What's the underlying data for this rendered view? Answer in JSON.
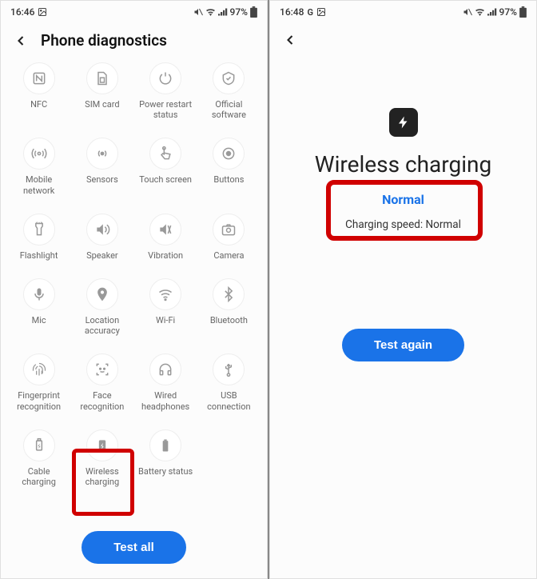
{
  "left": {
    "status": {
      "time": "16:46",
      "battery": "97%"
    },
    "title": "Phone diagnostics",
    "tiles": [
      {
        "id": "nfc",
        "label": "NFC"
      },
      {
        "id": "sim",
        "label": "SIM card"
      },
      {
        "id": "restart",
        "label": "Power restart\nstatus"
      },
      {
        "id": "software",
        "label": "Official\nsoftware"
      },
      {
        "id": "mobile",
        "label": "Mobile\nnetwork"
      },
      {
        "id": "sensors",
        "label": "Sensors"
      },
      {
        "id": "touch",
        "label": "Touch screen"
      },
      {
        "id": "buttons",
        "label": "Buttons"
      },
      {
        "id": "flashlight",
        "label": "Flashlight"
      },
      {
        "id": "speaker",
        "label": "Speaker"
      },
      {
        "id": "vibration",
        "label": "Vibration"
      },
      {
        "id": "camera",
        "label": "Camera"
      },
      {
        "id": "mic",
        "label": "Mic"
      },
      {
        "id": "location",
        "label": "Location\naccuracy"
      },
      {
        "id": "wifi",
        "label": "Wi-Fi"
      },
      {
        "id": "bluetooth",
        "label": "Bluetooth"
      },
      {
        "id": "fingerprint",
        "label": "Fingerprint\nrecognition"
      },
      {
        "id": "face",
        "label": "Face\nrecognition"
      },
      {
        "id": "headphones",
        "label": "Wired\nheadphones"
      },
      {
        "id": "usb",
        "label": "USB\nconnection"
      },
      {
        "id": "cable",
        "label": "Cable\ncharging"
      },
      {
        "id": "wireless",
        "label": "Wireless\ncharging"
      },
      {
        "id": "battery",
        "label": "Battery status"
      }
    ],
    "test_all": "Test all"
  },
  "right": {
    "status": {
      "time": "16:48",
      "battery": "97%"
    },
    "title": "Wireless charging",
    "result_status": "Normal",
    "result_detail": "Charging speed: Normal",
    "test_again": "Test again"
  }
}
